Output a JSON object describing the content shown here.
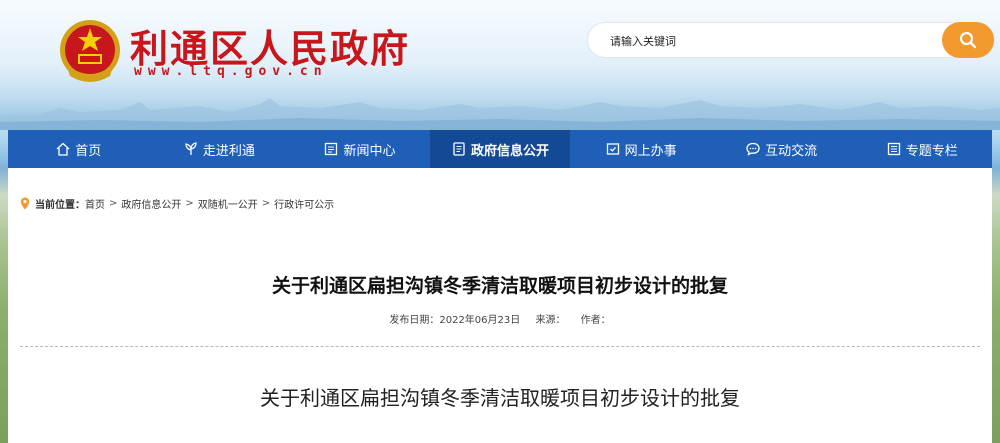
{
  "header": {
    "site_name": "利通区人民政府",
    "site_url": "www.ltq.gov.cn",
    "emblem_icon": "national-emblem-icon"
  },
  "search": {
    "placeholder": "请输入关键词",
    "button_icon": "search-icon"
  },
  "nav": {
    "items": [
      {
        "label": "首页",
        "icon": "home-icon"
      },
      {
        "label": "走进利通",
        "icon": "leaf-icon"
      },
      {
        "label": "新闻中心",
        "icon": "news-icon"
      },
      {
        "label": "政府信息公开",
        "icon": "document-icon",
        "active": true
      },
      {
        "label": "网上办事",
        "icon": "service-icon"
      },
      {
        "label": "互动交流",
        "icon": "chat-icon"
      },
      {
        "label": "专题专栏",
        "icon": "topic-icon"
      }
    ]
  },
  "breadcrumb": {
    "label": "当前位置：",
    "items": [
      "首页",
      "政府信息公开",
      "双随机一公开",
      "行政许可公示"
    ]
  },
  "article": {
    "title": "关于利通区扁担沟镇冬季清洁取暖项目初步设计的批复",
    "publish_date": "发布日期：2022年06月23日",
    "source": "来源：",
    "author": "作者：",
    "body_title": "关于利通区扁担沟镇冬季清洁取暖项目初步设计的批复"
  },
  "colors": {
    "brand_red": "#c8161d",
    "nav_blue": "#1f5fb8",
    "nav_active": "#144a95",
    "search_orange": "#f39a2e"
  }
}
